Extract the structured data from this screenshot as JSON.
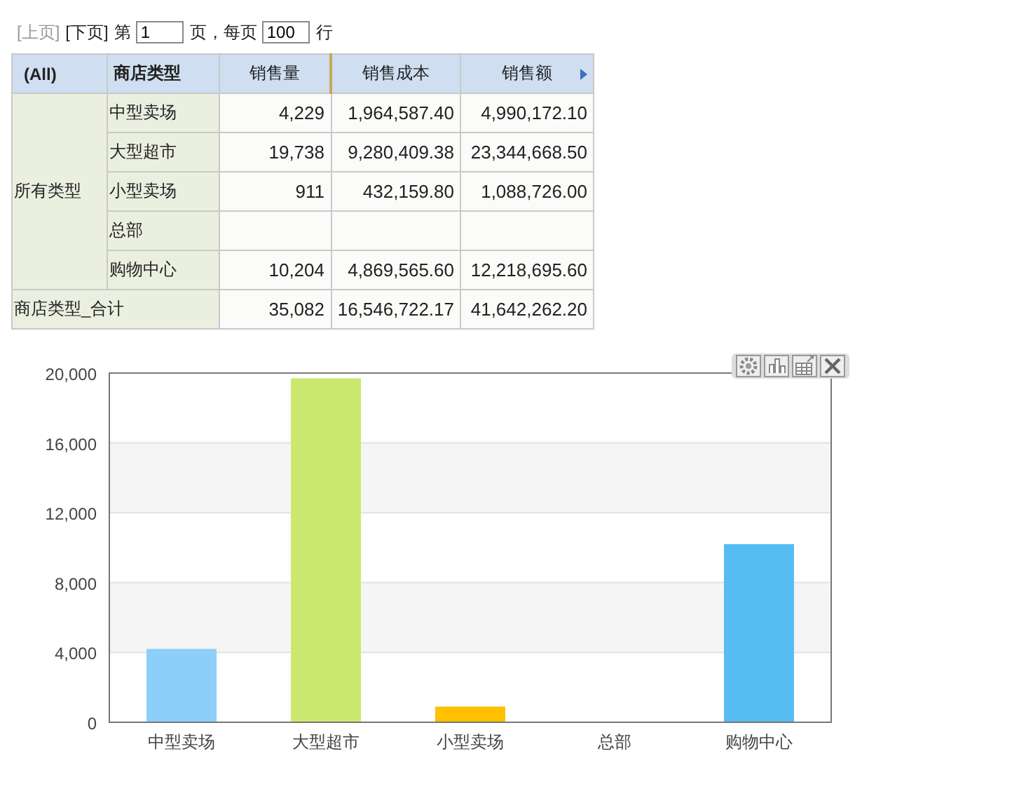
{
  "pager": {
    "prev": {
      "label": "[上页]",
      "disabled": true
    },
    "next": {
      "label": "[下页]",
      "disabled": false
    },
    "page_label": "第",
    "page": "1",
    "per_page_label": "页，每页",
    "per_page": "100",
    "rows_label": "行"
  },
  "table": {
    "columns": [
      "(All)",
      "商店类型",
      "销售量",
      "销售成本",
      "销售额"
    ],
    "group": "所有类型",
    "rows": [
      {
        "type": "中型卖场",
        "values": [
          "4,229",
          "1,964,587.40",
          "4,990,172.10"
        ]
      },
      {
        "type": "大型超市",
        "values": [
          "19,738",
          "9,280,409.38",
          "23,344,668.50"
        ]
      },
      {
        "type": "小型卖场",
        "values": [
          "911",
          "432,159.80",
          "1,088,726.00"
        ]
      },
      {
        "type": "总部",
        "values": []
      },
      {
        "type": "购物中心",
        "values": [
          "10,204",
          "4,869,565.60",
          "12,218,695.60"
        ]
      }
    ],
    "total": {
      "label": "商店类型_合计",
      "values": [
        "35,082",
        "16,546,722.17",
        "41,642,262.20"
      ]
    }
  },
  "chart": {
    "chart_data": {
      "type": "bar",
      "categories": [
        "中型卖场",
        "大型超市",
        "小型卖场",
        "总部",
        "购物中心"
      ],
      "values": [
        4200,
        19700,
        900,
        null,
        10200
      ],
      "colors": [
        "#8bcffa",
        "#cce96f",
        "#ffc000",
        null,
        "#56bdf2"
      ],
      "grid": true,
      "ylim": [
        0,
        20000
      ],
      "yticks": [
        {
          "value": 0,
          "label": "0"
        },
        {
          "value": 4000,
          "label": "4,000"
        },
        {
          "value": 8000,
          "label": "8,000"
        },
        {
          "value": 12000,
          "label": "12,000"
        },
        {
          "value": 16000,
          "label": "16,000"
        },
        {
          "value": 20000,
          "label": "20,000"
        }
      ]
    }
  }
}
